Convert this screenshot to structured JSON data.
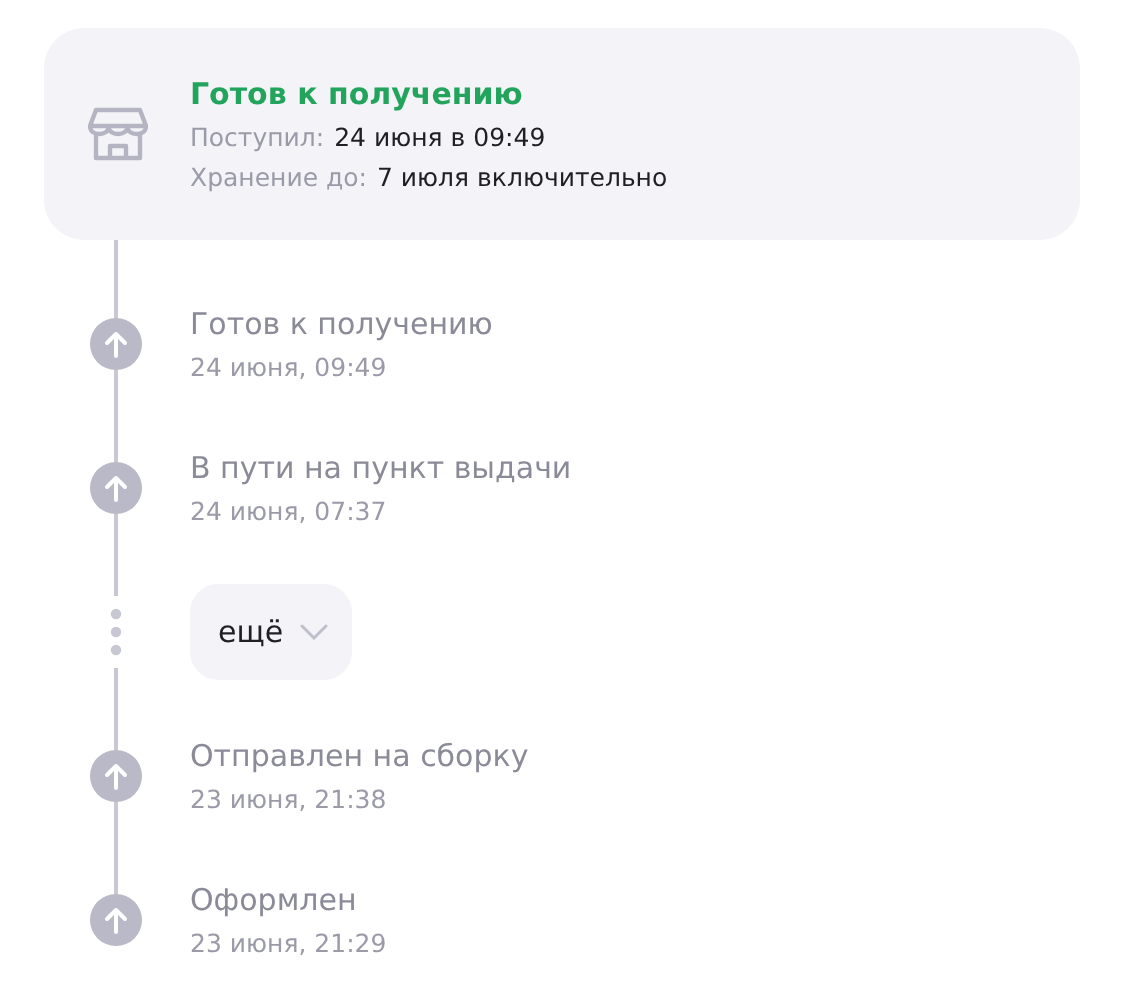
{
  "status_card": {
    "title": "Готов к получению",
    "received_label": "Поступил:",
    "received_value": "24 июня в 09:49",
    "storage_label": "Хранение до:",
    "storage_value": "7 июля включительно"
  },
  "timeline": [
    {
      "kind": "event",
      "title": "Готов к получению",
      "time": "24 июня, 09:49"
    },
    {
      "kind": "event",
      "title": "В пути на пункт выдачи",
      "time": "24 июня, 07:37"
    },
    {
      "kind": "more",
      "label": "ещё"
    },
    {
      "kind": "event",
      "title": "Отправлен на сборку",
      "time": "23 июня, 21:38"
    },
    {
      "kind": "event",
      "title": "Оформлен",
      "time": "23 июня, 21:29"
    }
  ]
}
